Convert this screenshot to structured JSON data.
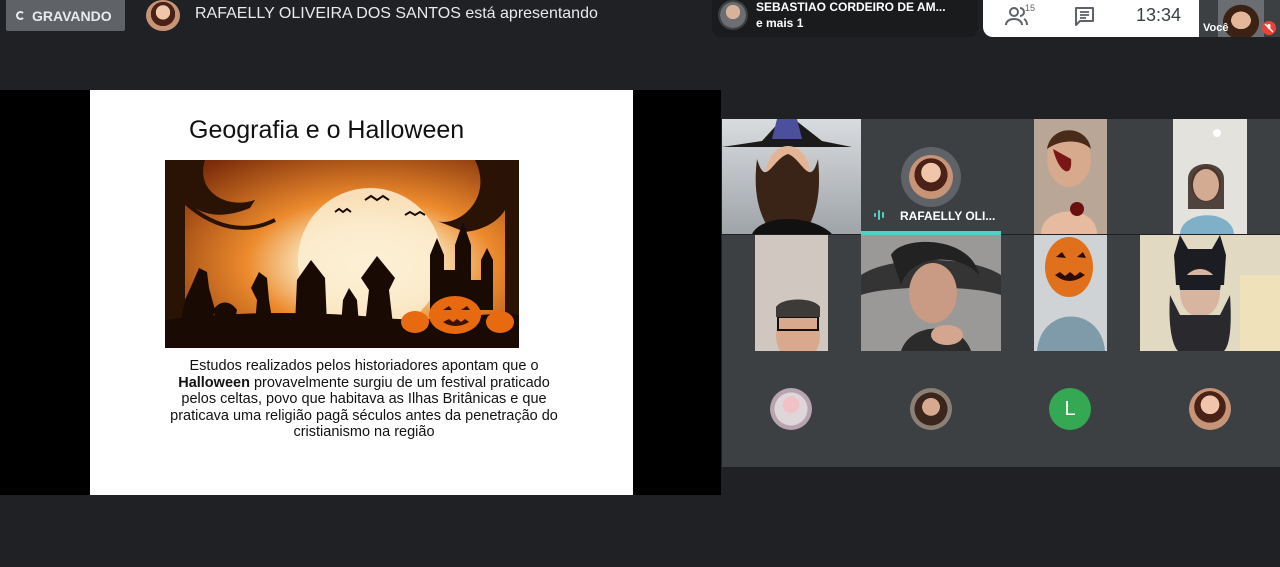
{
  "recording": {
    "label": "GRAVANDO"
  },
  "presenter": {
    "text": "RAFAELLY OLIVEIRA DOS SANTOS está apresentando"
  },
  "pinned": {
    "name": "SEBASTIAO CORDEIRO DE AM...",
    "more": "e mais 1"
  },
  "controls": {
    "people_count": "15",
    "time": "13:34"
  },
  "self": {
    "label": "Você"
  },
  "slide": {
    "title": "Geografia e o Halloween",
    "text_before": "Estudos realizados pelos historiadores apontam que o ",
    "text_bold": "Halloween",
    "text_after": " provavelmente surgiu de um festival praticado pelos celtas, povo que habitava as Ilhas Britânicas e que praticava uma religião pagã séculos antes da penetração do cristianismo na região"
  },
  "speaker": {
    "name": "RAFAELLY OLI..."
  },
  "avatars": {
    "letter": "L"
  },
  "icons": [
    "spinner-icon",
    "people-icon",
    "chat-icon",
    "mic-off-icon",
    "speaking-icon"
  ],
  "colors": {
    "background": "#202124",
    "tile": "#3c4043",
    "speaking": "#4fd1c5",
    "letter_avatar": "#34a853"
  }
}
